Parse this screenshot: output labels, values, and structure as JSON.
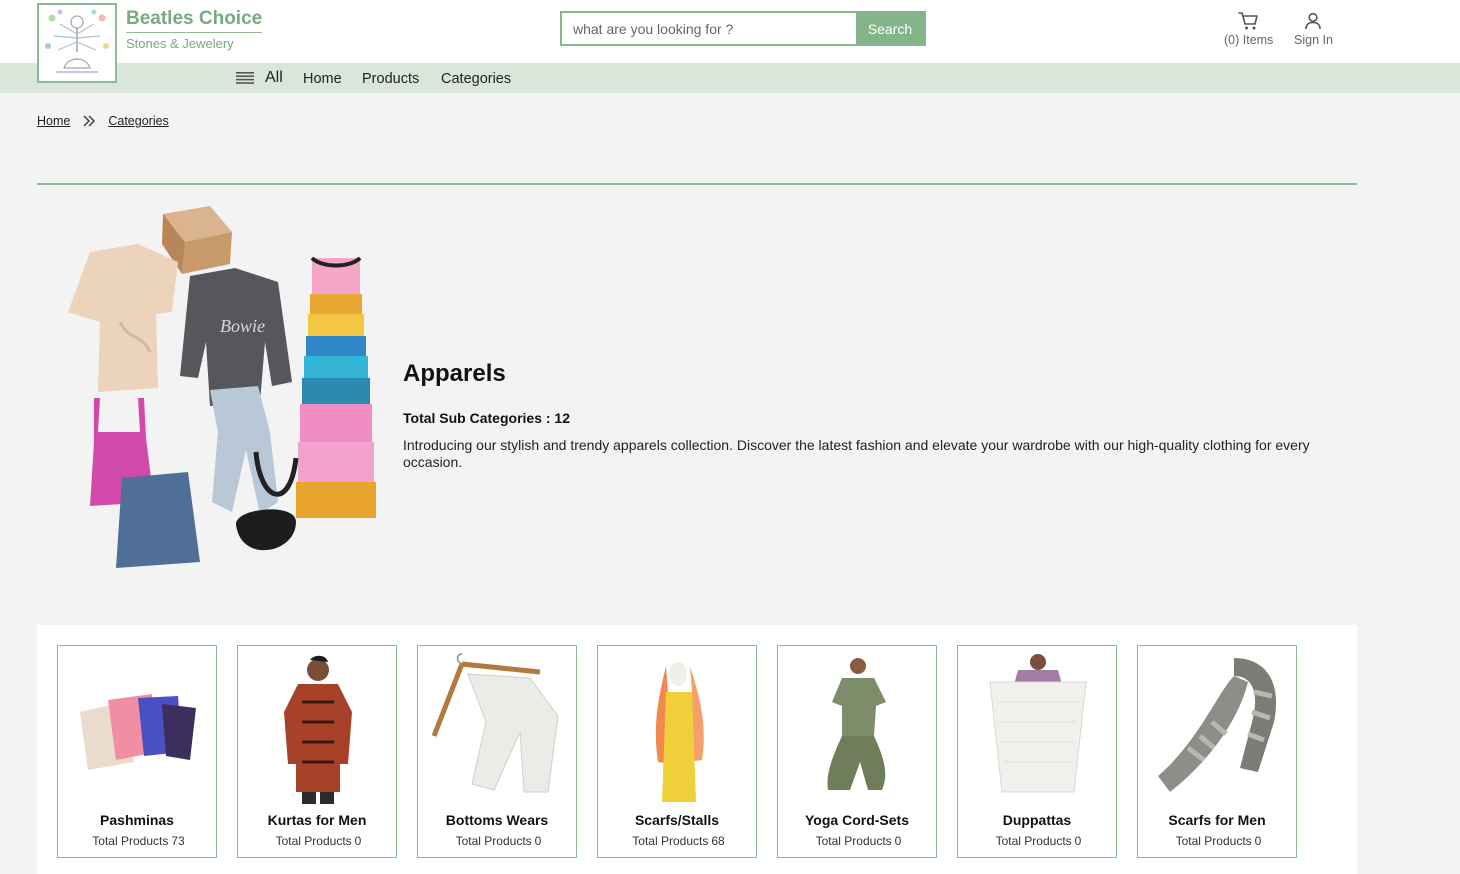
{
  "header": {
    "brand_name": "Beatles Choice",
    "brand_tagline": "Stones & Jewelery",
    "search_placeholder": "what are you looking for ?",
    "search_button": "Search",
    "cart_label": "(0) Items",
    "signin_label": "Sign In",
    "accent_color": "#84b489"
  },
  "nav": {
    "all_label": "All",
    "links": [
      "Home",
      "Products",
      "Categories"
    ]
  },
  "breadcrumb": {
    "items": [
      "Home",
      "Categories"
    ]
  },
  "category": {
    "title": "Apparels",
    "sub_count_label": "Total Sub Categories : 12",
    "description": "Introducing our stylish and trendy apparels collection. Discover the latest fashion and elevate your wardrobe with our high-quality clothing for every occasion."
  },
  "subcategories": [
    {
      "name": "Pashminas",
      "count_label": "Total Products",
      "count": "73"
    },
    {
      "name": "Kurtas for Men",
      "count_label": "Total Products",
      "count": "0"
    },
    {
      "name": "Bottoms Wears",
      "count_label": "Total Products",
      "count": "0"
    },
    {
      "name": "Scarfs/Stalls",
      "count_label": "Total Products",
      "count": "68"
    },
    {
      "name": "Yoga Cord-Sets",
      "count_label": "Total Products",
      "count": "0"
    },
    {
      "name": "Duppattas",
      "count_label": "Total Products",
      "count": "0"
    },
    {
      "name": "Scarfs for Men",
      "count_label": "Total Products",
      "count": "0"
    }
  ]
}
